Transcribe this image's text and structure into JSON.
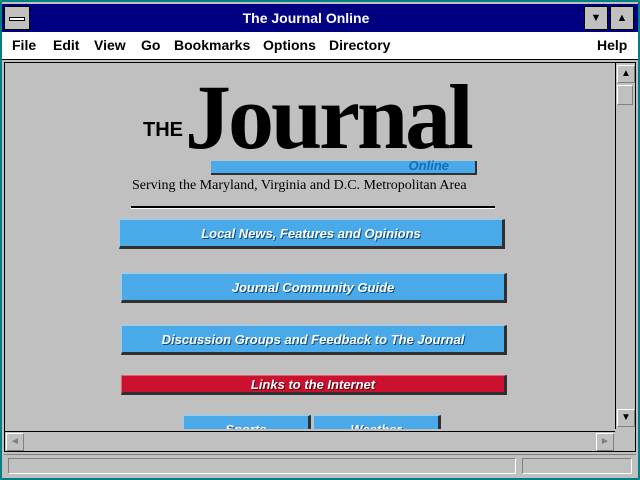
{
  "window": {
    "title": "The Journal Online",
    "minimize_glyph": "▼",
    "maximize_glyph": "▲"
  },
  "menu": {
    "items": [
      {
        "label": "File"
      },
      {
        "label": "Edit"
      },
      {
        "label": "View"
      },
      {
        "label": "Go"
      },
      {
        "label": "Bookmarks"
      },
      {
        "label": "Options"
      },
      {
        "label": "Directory"
      },
      {
        "label": "Help"
      }
    ]
  },
  "page": {
    "logo_the": "THE",
    "logo_journal": "Journal",
    "logo_online": "Online",
    "tagline": "Serving the Maryland, Virginia and D.C. Metropolitan Area",
    "links": [
      {
        "label": "Local News, Features and Opinions"
      },
      {
        "label": "Journal Community Guide"
      },
      {
        "label": "Discussion Groups and Feedback to The Journal"
      },
      {
        "label": "Links to the Internet"
      },
      {
        "label": "Sports"
      },
      {
        "label": "Weather"
      }
    ]
  },
  "scrollbars": {
    "up_glyph": "▲",
    "down_glyph": "▼",
    "left_glyph": "◄",
    "right_glyph": "►"
  },
  "colors": {
    "titlebar": "#000080",
    "link_button": "#4aa9e8",
    "internet_button": "#cc1030"
  }
}
